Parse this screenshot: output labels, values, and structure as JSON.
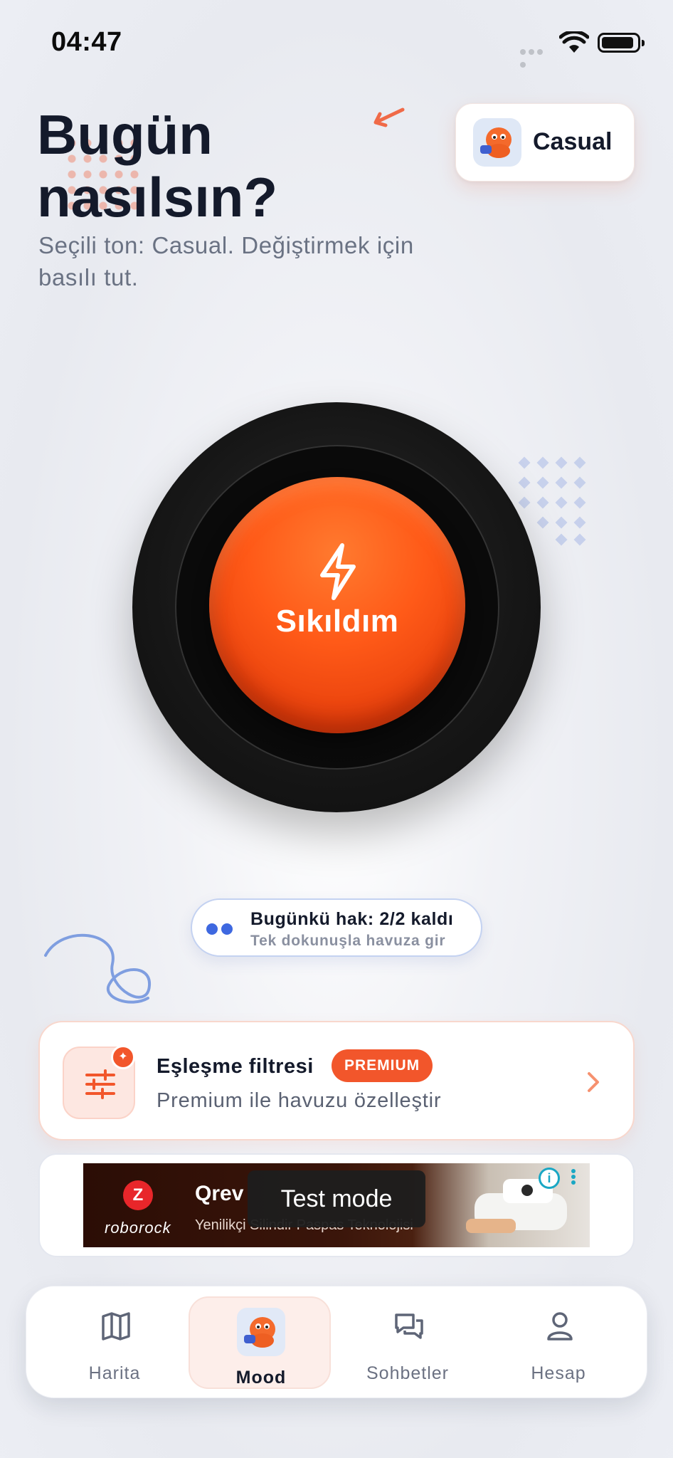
{
  "status_bar": {
    "time": "04:47"
  },
  "header": {
    "title": "Bugün nasılsın?",
    "subtitle": "Seçili ton: Casual. Değiştirmek için basılı tut."
  },
  "tone_chip": {
    "label": "Casual"
  },
  "main_button": {
    "label": "Sıkıldım"
  },
  "quota": {
    "title": "Bugünkü hak: 2/2 kaldı",
    "subtitle": "Tek dokunuşla havuza gir"
  },
  "filter_card": {
    "title": "Eşleşme filtresi",
    "badge": "PREMIUM",
    "subtitle": "Premium ile havuzu özelleştir"
  },
  "ad": {
    "brand": "roborock",
    "headline": "Qrev",
    "subtitle": "Yenilikçi Silindir Paspas Teknolojisi",
    "overlay": "Test mode"
  },
  "nav": {
    "items": [
      {
        "label": "Harita",
        "icon": "map-icon"
      },
      {
        "label": "Mood",
        "icon": "mascot-avatar",
        "active": true
      },
      {
        "label": "Sohbetler",
        "icon": "chat-icon"
      },
      {
        "label": "Hesap",
        "icon": "user-icon"
      }
    ]
  },
  "colors": {
    "accent": "#f2562b",
    "button_orange": "#ff5a18",
    "quota_blue": "#3e68e0",
    "text_dark": "#141a2b",
    "text_muted": "#6a7283"
  }
}
